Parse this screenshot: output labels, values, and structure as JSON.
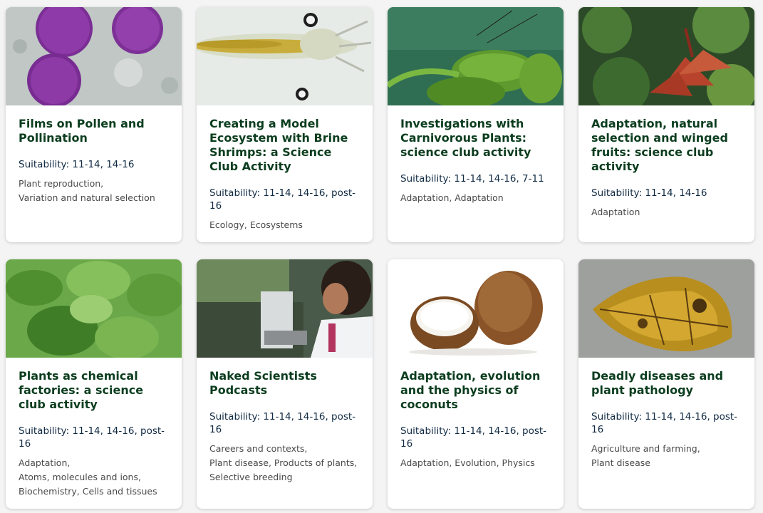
{
  "cards": [
    {
      "title": "Films on Pollen and Pollination",
      "suitability": "Suitability: 11-14, 14-16",
      "tags": [
        "Plant reproduction,",
        "Variation and natural selection"
      ],
      "image_icon": "pollen-image"
    },
    {
      "title": "Creating a Model Ecosystem with Brine Shrimps: a Science Club Activity",
      "suitability": "Suitability: 11-14, 14-16, post-16",
      "tags": [
        "Ecology, Ecosystems"
      ],
      "image_icon": "brine-shrimp-image"
    },
    {
      "title": "Investigations with Carnivorous Plants: science club activity",
      "suitability": "Suitability: 11-14, 14-16, 7-11",
      "tags": [
        "Adaptation, Adaptation"
      ],
      "image_icon": "venus-flytrap-image"
    },
    {
      "title": "Adaptation, natural selection and winged fruits: science club activity",
      "suitability": "Suitability: 11-14, 14-16",
      "tags": [
        "Adaptation"
      ],
      "image_icon": "winged-fruits-image"
    },
    {
      "title": "Plants as chemical factories: a science club activity",
      "suitability": "Suitability: 11-14, 14-16, post-16",
      "tags": [
        "Adaptation,",
        "Atoms, molecules and ions,",
        "Biochemistry, Cells and tissues"
      ],
      "image_icon": "basil-leaves-image"
    },
    {
      "title": "Naked Scientists Podcasts",
      "suitability": "Suitability: 11-14, 14-16, post-16",
      "tags": [
        "Careers and contexts,",
        "Plant disease, Products of plants,",
        "Selective breeding"
      ],
      "image_icon": "scientist-microscope-image"
    },
    {
      "title": "Adaptation, evolution and the physics of coconuts",
      "suitability": "Suitability: 11-14, 14-16, post-16",
      "tags": [
        "Adaptation, Evolution, Physics"
      ],
      "image_icon": "coconuts-image"
    },
    {
      "title": "Deadly diseases and plant pathology",
      "suitability": "Suitability: 11-14, 14-16, post-16",
      "tags": [
        "Agriculture and farming,",
        "Plant disease"
      ],
      "image_icon": "diseased-leaf-image"
    }
  ]
}
